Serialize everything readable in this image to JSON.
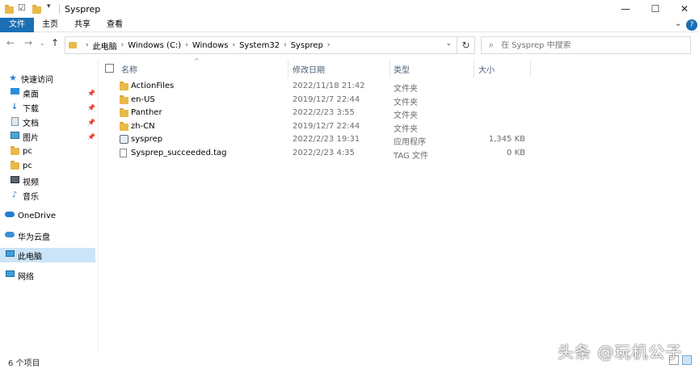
{
  "window": {
    "title": "Sysprep",
    "minimize_glyph": "—",
    "maximize_glyph": "☐",
    "close_glyph": "✕"
  },
  "ribbon": {
    "tabs": [
      {
        "label": "文件"
      },
      {
        "label": "主页"
      },
      {
        "label": "共享"
      },
      {
        "label": "查看"
      }
    ],
    "help_glyph": "?"
  },
  "address": {
    "crumbs": [
      "此电脑",
      "Windows (C:)",
      "Windows",
      "System32",
      "Sysprep"
    ],
    "search_placeholder": "在 Sysprep 中搜索"
  },
  "nav": {
    "items": [
      {
        "label": "快速访问",
        "icon": "star-icon"
      },
      {
        "label": "桌面",
        "icon": "desktop-icon",
        "pinned": true
      },
      {
        "label": "下载",
        "icon": "download-icon",
        "pinned": true
      },
      {
        "label": "文档",
        "icon": "document-icon",
        "pinned": true
      },
      {
        "label": "图片",
        "icon": "picture-icon",
        "pinned": true
      },
      {
        "label": "pc",
        "icon": "folder-icon"
      },
      {
        "label": "pc",
        "icon": "folder-icon"
      },
      {
        "label": "视频",
        "icon": "video-icon"
      },
      {
        "label": "音乐",
        "icon": "music-icon"
      },
      {
        "label": "OneDrive",
        "icon": "onedrive-icon"
      },
      {
        "label": "华为云盘",
        "icon": "cloud-icon"
      },
      {
        "label": "此电脑",
        "icon": "computer-icon"
      },
      {
        "label": "网络",
        "icon": "network-icon"
      }
    ]
  },
  "columns": {
    "name": "名称",
    "date": "修改日期",
    "type": "类型",
    "size": "大小"
  },
  "files": [
    {
      "name": "ActionFiles",
      "date": "2022/11/18 21:42",
      "type": "文件夹",
      "size": "",
      "icon": "folder-icon"
    },
    {
      "name": "en-US",
      "date": "2019/12/7 22:44",
      "type": "文件夹",
      "size": "",
      "icon": "folder-icon"
    },
    {
      "name": "Panther",
      "date": "2022/2/23 3:55",
      "type": "文件夹",
      "size": "",
      "icon": "folder-icon"
    },
    {
      "name": "zh-CN",
      "date": "2019/12/7 22:44",
      "type": "文件夹",
      "size": "",
      "icon": "folder-icon"
    },
    {
      "name": "sysprep",
      "date": "2022/2/23 19:31",
      "type": "应用程序",
      "size": "1,345 KB",
      "icon": "application-icon"
    },
    {
      "name": "Sysprep_succeeded.tag",
      "date": "2022/2/23 4:35",
      "type": "TAG 文件",
      "size": "0 KB",
      "icon": "file-icon"
    }
  ],
  "status": {
    "item_count": "6 个项目"
  },
  "watermark": "头条 @玩机公子"
}
